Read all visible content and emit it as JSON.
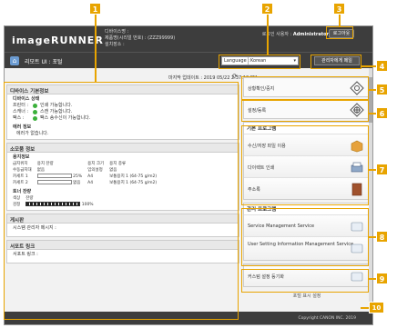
{
  "header": {
    "logo": "imageRUNNER",
    "device_name_label": "디바이스명 :",
    "product_name_label": "제품명(시리얼 번호) : (ZZZ99999)",
    "location_label": "설치장소 :",
    "user_label": "로그인 사용자 :",
    "user_name": "Administrator",
    "logout_label": "로그아웃"
  },
  "toolbar": {
    "breadcrumb": "리모트 UI : 포털",
    "language_label": "Language :",
    "language_value": "Korean",
    "mail_button": "관리자에게 메일"
  },
  "status_bar": {
    "last_updated": "마지막 업데이트 : 2019 05/22 2:37:12 PM"
  },
  "device_status": {
    "title": "디바이스 기본정보",
    "section_title": "디바이스 상태",
    "rows": [
      {
        "key": "프린터 :",
        "value": "인쇄 가능합니다."
      },
      {
        "key": "스캐너 :",
        "value": "스캔 가능합니다."
      },
      {
        "key": "팩스 :",
        "value": "팩스 송수신이 가능합니다."
      }
    ],
    "error_title": "에러 정보",
    "error_text": "에러가 없습니다."
  },
  "consumables": {
    "title": "소모품 정보",
    "paper_title": "용지정보",
    "paper_headers": [
      "급지위치",
      "용지 잔량",
      "용지 크기",
      "용지 종류"
    ],
    "paper_rows": [
      {
        "source": "수동급지대",
        "remaining": "없음",
        "size": "임의설정",
        "type": "없음"
      },
      {
        "source": "카세트 1",
        "remaining": "25%",
        "size": "A4",
        "type": "보통용지 1 (64-75 g/m2)"
      },
      {
        "source": "카세트 2",
        "remaining": "없음",
        "size": "A4",
        "type": "보통용지 1 (64-75 g/m2)"
      }
    ],
    "toner_title": "토너 잔량",
    "toner_headers": [
      "색상",
      "잔량"
    ],
    "toner_color": "검정",
    "toner_level": "100%"
  },
  "messages": {
    "title": "게시판",
    "text": "시스템 관리자 메시지 :"
  },
  "support": {
    "title": "서포트 링크",
    "text": "서포트 링크 :"
  },
  "right_menu": {
    "status_monitor": "상황확인/중지",
    "settings": "설정/등록",
    "basic_title": "기본 프로그램",
    "basic_items": [
      "수신/저장 파일 이용",
      "다이렉트 인쇄",
      "주소록"
    ],
    "mgmt_title": "관리 프로그램",
    "mgmt_items": [
      "Service Management Service",
      "User Setting Information Management Service"
    ],
    "custom": "커스텀 설정 등기화",
    "portal": "포털 표시 설정"
  },
  "footer": {
    "copyright": "Copyright CANON INC. 2019"
  },
  "callouts": [
    "1",
    "2",
    "3",
    "4",
    "5",
    "6",
    "7",
    "8",
    "9",
    "10"
  ],
  "colors": {
    "accent": "#e8a400",
    "header_bg": "#3d3d3d",
    "ok_green": "#3bb03b"
  }
}
